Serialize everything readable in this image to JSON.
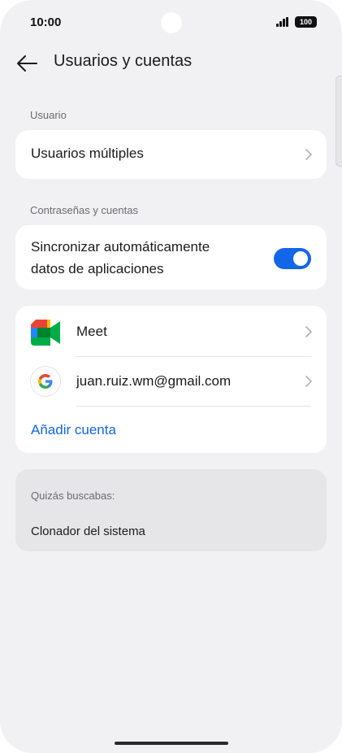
{
  "status_bar": {
    "time": "10:00",
    "battery": "100"
  },
  "header": {
    "title": "Usuarios y cuentas"
  },
  "users_section": {
    "label": "Usuario",
    "item": "Usuarios múltiples"
  },
  "accounts_section": {
    "label": "Contraseñas y cuentas",
    "sync": {
      "label_line1": "Sincronizar automáticamente",
      "label_line2": "datos de aplicaciones",
      "enabled": true
    },
    "accounts": [
      {
        "name": "Meet",
        "icon": "google-meet-icon"
      },
      {
        "name": "juan.ruiz.wm@gmail.com",
        "icon": "google-icon"
      }
    ],
    "add_account": "Añadir cuenta"
  },
  "suggestions": {
    "label": "Quizás buscabas:",
    "items": [
      "Clonador del sistema"
    ]
  },
  "colors": {
    "accent": "#1366e8",
    "background": "#f1f1f4",
    "card": "#ffffff"
  }
}
